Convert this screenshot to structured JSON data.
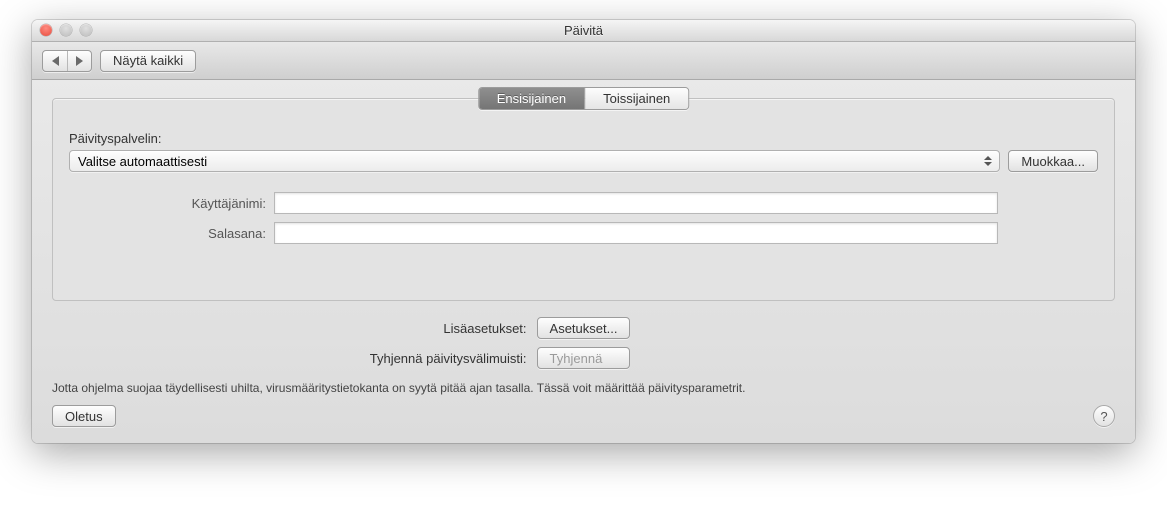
{
  "window": {
    "title": "Päivitä"
  },
  "toolbar": {
    "show_all": "Näytä kaikki"
  },
  "tabs": {
    "primary": "Ensisijainen",
    "secondary": "Toissijainen"
  },
  "server": {
    "label": "Päivityspalvelin:",
    "selected": "Valitse automaattisesti",
    "edit": "Muokkaa..."
  },
  "fields": {
    "username_label": "Käyttäjänimi:",
    "username_value": "",
    "password_label": "Salasana:",
    "password_value": ""
  },
  "actions": {
    "advanced_label": "Lisäasetukset:",
    "advanced_btn": "Asetukset...",
    "clear_label": "Tyhjennä päivitysvälimuisti:",
    "clear_btn": "Tyhjennä"
  },
  "hint": "Jotta ohjelma suojaa täydellisesti uhilta, virusmääritystietokanta on syytä pitää ajan tasalla. Tässä voit määrittää päivitysparametrit.",
  "bottom": {
    "default": "Oletus",
    "help": "?"
  }
}
